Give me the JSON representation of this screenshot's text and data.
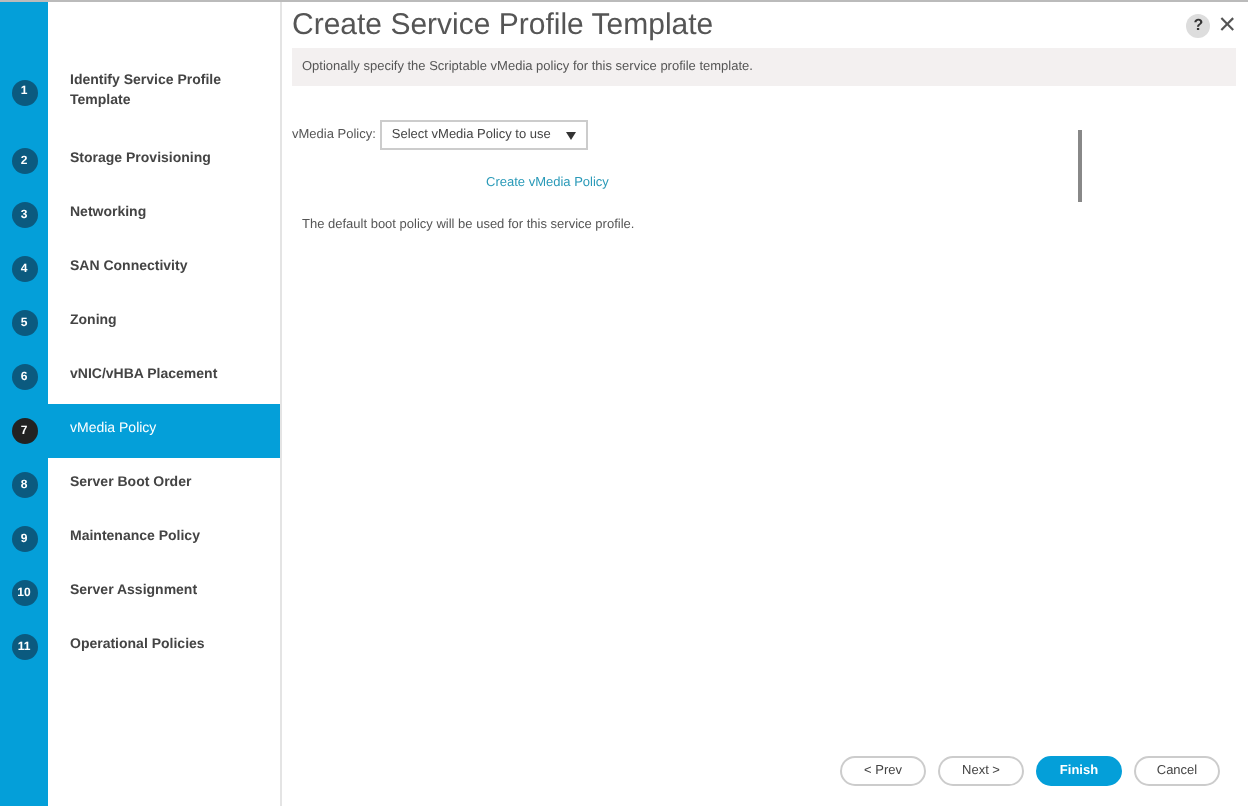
{
  "steps": [
    {
      "number": "1",
      "label": "Identify Service Profile Template",
      "selected": false
    },
    {
      "number": "2",
      "label": "Storage Provisioning",
      "selected": false
    },
    {
      "number": "3",
      "label": "Networking",
      "selected": false
    },
    {
      "number": "4",
      "label": "SAN Connectivity",
      "selected": false
    },
    {
      "number": "5",
      "label": "Zoning",
      "selected": false
    },
    {
      "number": "6",
      "label": "vNIC/vHBA Placement",
      "selected": false
    },
    {
      "number": "7",
      "label": "vMedia Policy",
      "selected": true
    },
    {
      "number": "8",
      "label": "Server Boot Order",
      "selected": false
    },
    {
      "number": "9",
      "label": "Maintenance Policy",
      "selected": false
    },
    {
      "number": "10",
      "label": "Server Assignment",
      "selected": false
    },
    {
      "number": "11",
      "label": "Operational Policies",
      "selected": false
    }
  ],
  "window": {
    "title": "Create Service Profile Template",
    "help": "?",
    "close": "×"
  },
  "info": "Optionally specify the Scriptable vMedia policy for this service profile template.",
  "vmedia_policy": {
    "label": "vMedia Policy:",
    "value": "Select vMedia Policy to use"
  },
  "create_link": "Create vMedia Policy",
  "note": "The default boot policy will be used for this service profile.",
  "buttons": [
    {
      "label": "< Prev",
      "kind": "default"
    },
    {
      "label": "Next >",
      "kind": "default"
    },
    {
      "label": "Finish",
      "kind": "primary"
    },
    {
      "label": "Cancel",
      "kind": "default"
    }
  ]
}
